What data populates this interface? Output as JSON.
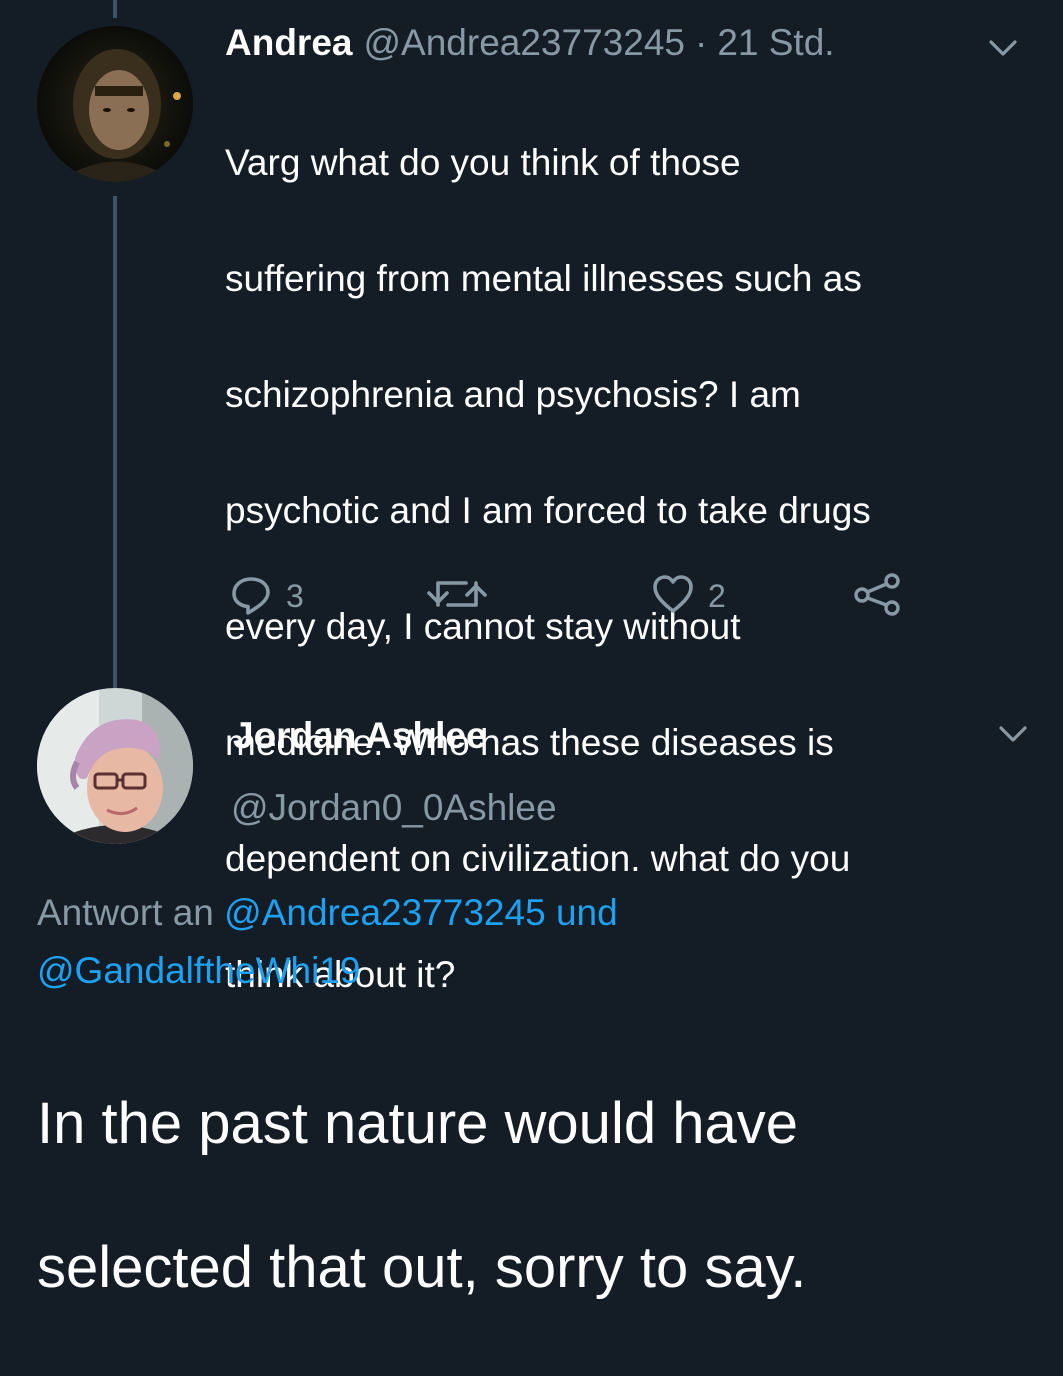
{
  "original_tweet": {
    "author_name": "Andrea",
    "author_handle": "@Andrea23773245",
    "time_sep": "·",
    "time": "21 Std.",
    "text_lines": [
      "Varg what do you think of those",
      "suffering from mental illnesses such as",
      "schizophrenia and psychosis? I am",
      "psychotic and I am forced to take drugs",
      "every day, I cannot stay without",
      "medicine. Who has these diseases is",
      "dependent on civilization. what do you",
      "think about it?"
    ],
    "reply_count": "3",
    "like_count": "2",
    "icons": [
      "reply-icon",
      "retweet-icon",
      "like-icon",
      "share-icon",
      "chevron-down-icon"
    ]
  },
  "reply_tweet": {
    "author_name": "Jordan Ashlee",
    "author_handle": "@Jordan0_0Ashlee",
    "replying_to_prefix": "Antwort an",
    "replying_to_user1": "@Andrea23773245",
    "replying_to_joiner": "und",
    "replying_to_user2": "@GandalftheWhi19",
    "text_lines": [
      "In the past nature would have",
      "selected that out, sorry to say."
    ]
  },
  "colors": {
    "background": "#141d26",
    "text": "#ffffff",
    "muted": "#8899a6",
    "link": "#1da1f2",
    "thread_line": "#3d5466"
  }
}
